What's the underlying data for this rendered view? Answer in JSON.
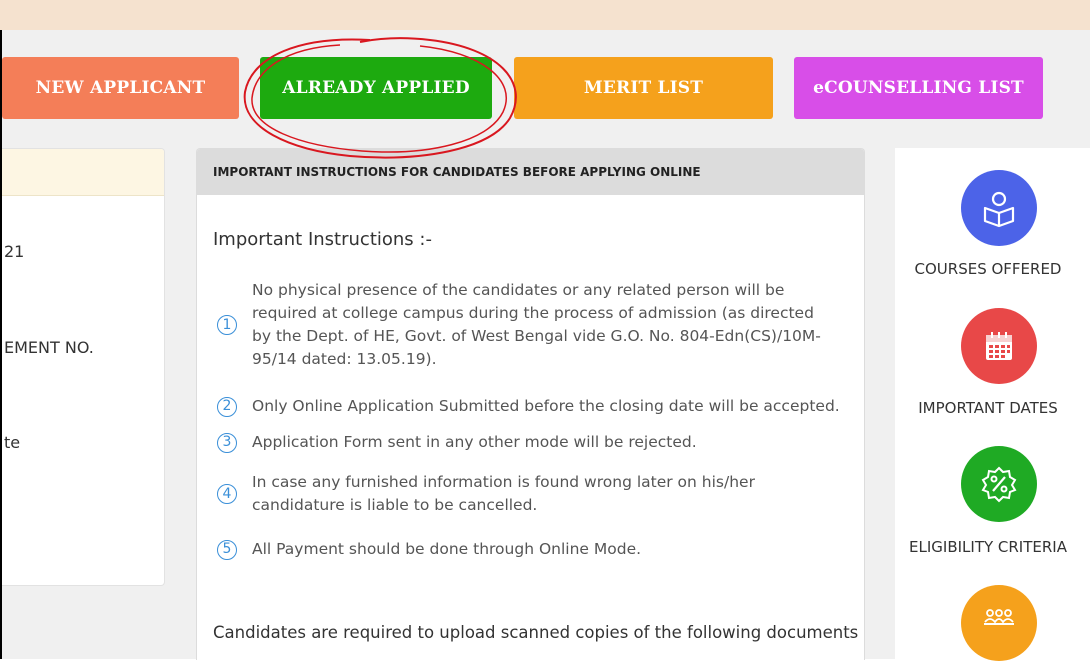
{
  "nav": {
    "new_applicant": "NEW APPLICANT",
    "already_applied": "ALREADY APPLIED",
    "merit_list": "MERIT LIST",
    "ecounselling_list": "eCOUNSELLING LIST"
  },
  "left_panel": {
    "lines": [
      "21",
      "EMENT NO.",
      "te"
    ]
  },
  "instructions": {
    "header": "IMPORTANT INSTRUCTIONS FOR CANDIDATES BEFORE APPLYING ONLINE",
    "intro": "Important Instructions :-",
    "items": [
      {
        "num": "1",
        "text": "No physical presence of the candidates or any related person will be required at college campus during the process of admission (as directed by the Dept. of HE, Govt. of West Bengal vide G.O. No. 804-Edn(CS)/10M-95/14 dated: 13.05.19)."
      },
      {
        "num": "2",
        "text": "Only Online Application Submitted before the closing date will be accepted."
      },
      {
        "num": "3",
        "text": "Application Form sent in any other mode will be rejected."
      },
      {
        "num": "4",
        "text": "In case any furnished information is found wrong later on his/her candidature is liable to be cancelled."
      },
      {
        "num": "5",
        "text": "All Payment should be done through Online Mode."
      }
    ],
    "documents_note": "Candidates are required to upload scanned copies of the following documents"
  },
  "quick_links": [
    {
      "label": "COURSES OFFERED",
      "icon": "reading-person-icon",
      "color": "#4c63e8"
    },
    {
      "label": "IMPORTANT DATES",
      "icon": "calendar-icon",
      "color": "#e84848"
    },
    {
      "label": "ELIGIBILITY CRITERIA",
      "icon": "percent-badge-icon",
      "color": "#1faa24"
    },
    {
      "label": "",
      "icon": "group-icon",
      "color": "#f5a11c"
    }
  ],
  "colors": {
    "top_bar": "#f5e2cf",
    "new_applicant": "#f47e58",
    "already_applied": "#1daa0f",
    "merit_list": "#f5a11c",
    "ecounselling_list": "#d84ee8",
    "annotation_circle": "#d9171f"
  }
}
